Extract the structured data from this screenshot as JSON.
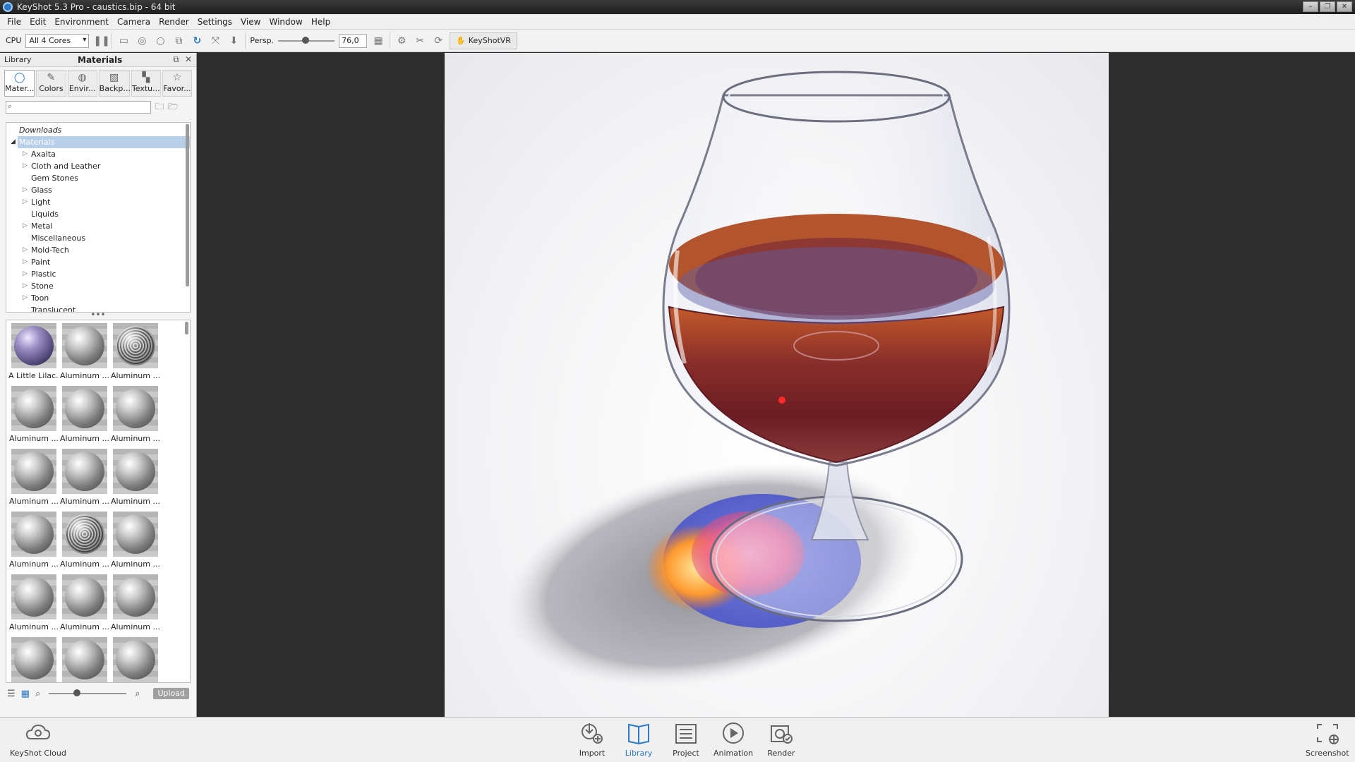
{
  "window": {
    "title": "KeyShot 5.3 Pro  - caustics.bip  - 64 bit",
    "controls": [
      "–",
      "❐",
      "✕"
    ]
  },
  "menu": [
    "File",
    "Edit",
    "Environment",
    "Camera",
    "Render",
    "Settings",
    "View",
    "Window",
    "Help"
  ],
  "toolbar": {
    "cpu_label": "CPU",
    "cores_value": "All 4 Cores",
    "persp_label": "Persp.",
    "fov_value": "76,0",
    "vr_label": "KeyShotVR"
  },
  "library": {
    "title": "Library",
    "subtitle": "Materials",
    "tabs": [
      "Mater...",
      "Colors",
      "Envir...",
      "Backp...",
      "Textu...",
      "Favor..."
    ],
    "search_placeholder": "",
    "tree": {
      "downloads": "Downloads",
      "root": "Materials",
      "items": [
        {
          "label": "Axalta",
          "expandable": true
        },
        {
          "label": "Cloth and Leather",
          "expandable": true
        },
        {
          "label": "Gem Stones",
          "expandable": false
        },
        {
          "label": "Glass",
          "expandable": true
        },
        {
          "label": "Light",
          "expandable": true
        },
        {
          "label": "Liquids",
          "expandable": false
        },
        {
          "label": "Metal",
          "expandable": true
        },
        {
          "label": "Miscellaneous",
          "expandable": false
        },
        {
          "label": "Mold-Tech",
          "expandable": true
        },
        {
          "label": "Paint",
          "expandable": true
        },
        {
          "label": "Plastic",
          "expandable": true
        },
        {
          "label": "Stone",
          "expandable": true
        },
        {
          "label": "Toon",
          "expandable": true
        },
        {
          "label": "Translucent",
          "expandable": false
        }
      ]
    },
    "thumbnails": [
      "A Little Lilac...",
      "Aluminum ...",
      "Aluminum ...",
      "Aluminum ...",
      "Aluminum ...",
      "Aluminum ...",
      "Aluminum ...",
      "Aluminum ...",
      "Aluminum ...",
      "Aluminum ...",
      "Aluminum ...",
      "Aluminum ...",
      "Aluminum ...",
      "Aluminum ...",
      "Aluminum ...",
      "",
      "",
      ""
    ],
    "upload_label": "Upload"
  },
  "bottombar": {
    "cloud": "KeyShot Cloud",
    "import": "Import",
    "library": "Library",
    "project": "Project",
    "animation": "Animation",
    "render": "Render",
    "screenshot": "Screenshot"
  },
  "colors": {
    "accent": "#2a78c8",
    "viewport_bg": "#2d2d2d",
    "selection": "#b8cfea"
  }
}
